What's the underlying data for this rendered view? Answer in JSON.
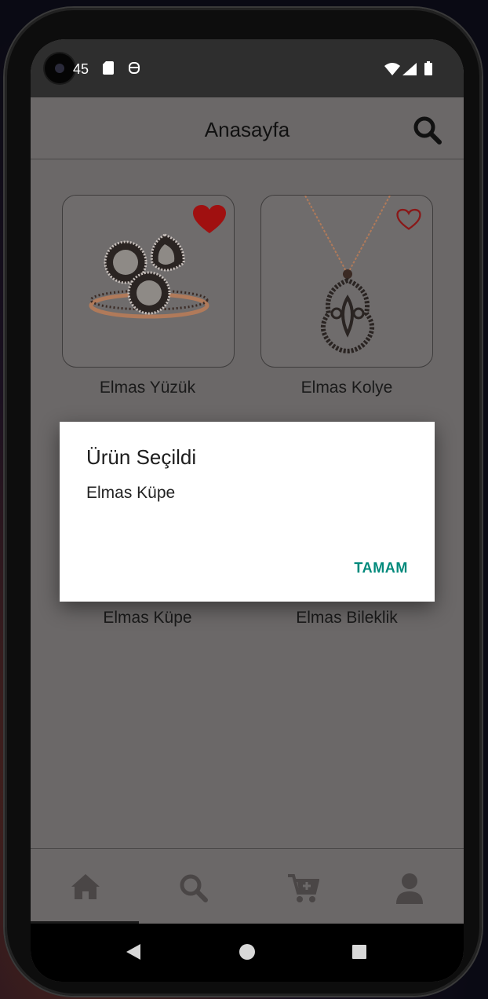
{
  "status_bar": {
    "time": "45"
  },
  "app_bar": {
    "title": "Anasayfa",
    "search_icon": "search-icon"
  },
  "products": [
    {
      "name": "Elmas Yüzük",
      "favorite": true
    },
    {
      "name": "Elmas Kolye",
      "favorite": false
    },
    {
      "name": "Elmas Küpe",
      "favorite": false
    },
    {
      "name": "Elmas Bileklik",
      "favorite": false
    }
  ],
  "dialog": {
    "title": "Ürün Seçildi",
    "message": "Elmas Küpe",
    "confirm_label": "TAMAM",
    "accent": "#00897b"
  },
  "bottom_nav": {
    "items": [
      {
        "icon": "home-icon",
        "active": true
      },
      {
        "icon": "search-icon",
        "active": false
      },
      {
        "icon": "cart-add-icon",
        "active": false
      },
      {
        "icon": "person-icon",
        "active": false
      }
    ]
  },
  "colors": {
    "favorite": "#a01010",
    "scrim_bg": "#6b6868"
  }
}
